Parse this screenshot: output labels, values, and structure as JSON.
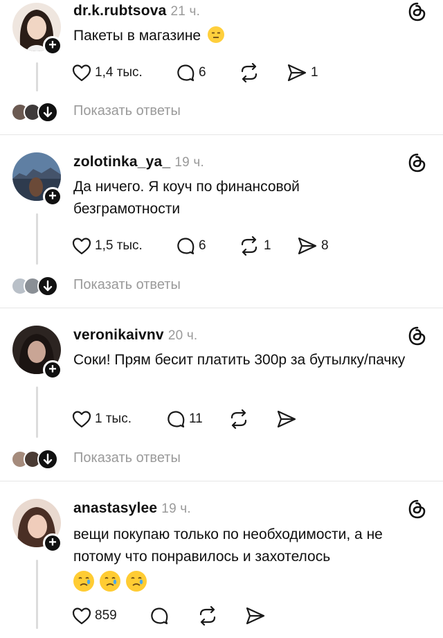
{
  "posts": [
    {
      "username": "dr.k.rubtsova",
      "time": "21 ч.",
      "text": "Пакеты в магазине",
      "emoji_icon": "expressionless-face-emoji",
      "likes": "1,4 тыс.",
      "comments": "6",
      "reposts": "",
      "shares": "1",
      "show_replies": "Показать ответы"
    },
    {
      "username": "zolotinka_ya_",
      "time": "19 ч.",
      "text": "Да ничего. Я коуч по финансовой безграмотности",
      "likes": "1,5 тыс.",
      "comments": "6",
      "reposts": "1",
      "shares": "8",
      "show_replies": "Показать ответы"
    },
    {
      "username": "veronikaivnv",
      "time": "20 ч.",
      "text": "Соки! Прям бесит платить 300р за бутылку/пачку",
      "likes": "1 тыс.",
      "comments": "11",
      "reposts": "",
      "shares": "",
      "show_replies": "Показать ответы"
    },
    {
      "username": "anastasylee",
      "time": "19 ч.",
      "text": "вещи покупаю только по необходимости, а не потому что понравилось и захотелось",
      "emoji_icons": [
        "crying-face-emoji",
        "crying-face-emoji",
        "crying-face-emoji"
      ],
      "likes": "859",
      "comments": "",
      "reposts": "",
      "shares": ""
    }
  ],
  "icons": {
    "follow": "plus-icon",
    "like": "heart-icon",
    "comment": "comment-bubble-icon",
    "repost": "repost-icon",
    "share": "send-icon",
    "threads": "threads-logo-icon",
    "expand": "arrow-down-icon"
  },
  "colors": {
    "text": "#101010",
    "muted": "#9a9a9a",
    "divider": "#e6e6e6"
  }
}
